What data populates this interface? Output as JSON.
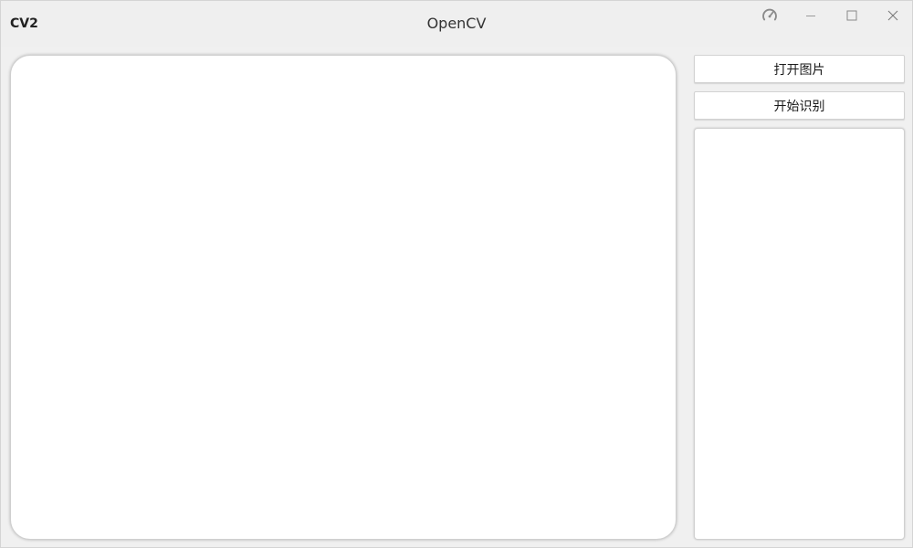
{
  "window": {
    "app_label": "CV2",
    "title": "OpenCV",
    "controls": {
      "speed_icon": "gauge-icon",
      "minimize_icon": "minimize-icon",
      "maximize_icon": "maximize-icon",
      "close_icon": "close-icon"
    }
  },
  "actions": {
    "open_image_label": "打开图片",
    "start_recognition_label": "开始识别"
  }
}
